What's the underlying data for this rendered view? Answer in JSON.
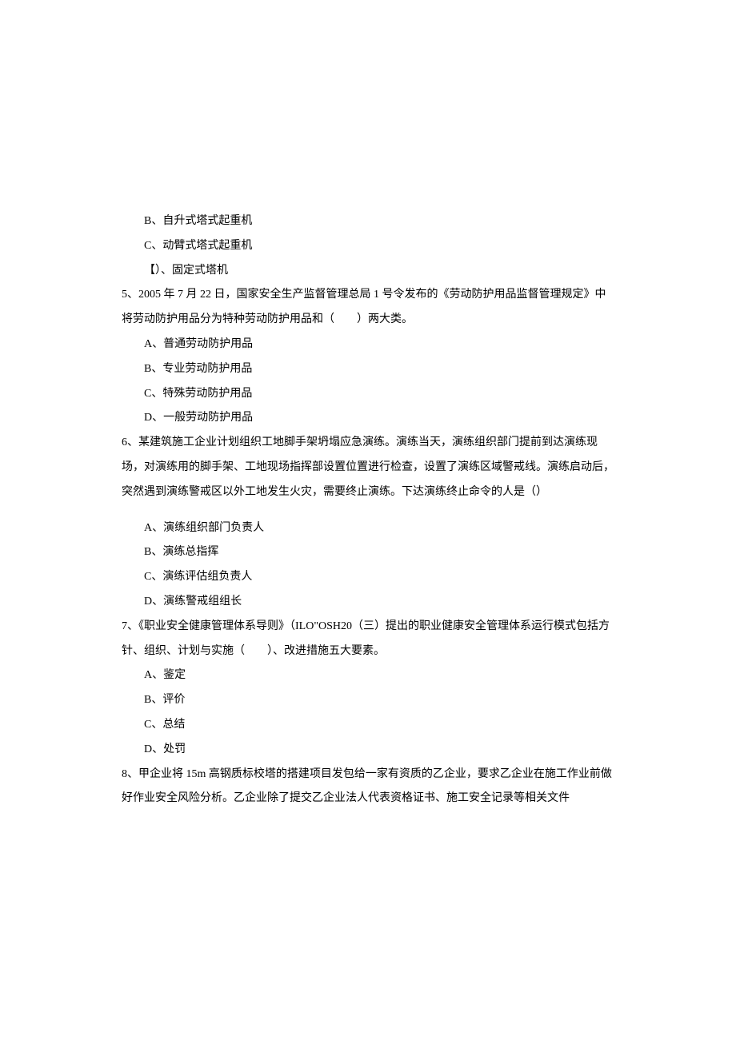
{
  "q4": {
    "options": {
      "b": "B、自升式塔式起重机",
      "c": "C、动臂式塔式起重机",
      "d": "【）、固定式塔机"
    }
  },
  "q5": {
    "stem": "5、2005 年 7 月 22 日，国家安全生产监督管理总局 1 号令发布的《劳动防护用品监督管理规定》中将劳动防护用品分为特种劳动防护用品和（　　）两大类。",
    "options": {
      "a": "A、普通劳动防护用品",
      "b": "B、专业劳动防护用品",
      "c": "C、特殊劳动防护用品",
      "d": "D、一般劳动防护用品"
    }
  },
  "q6": {
    "stem": "6、某建筑施工企业计划组织工地脚手架坍塌应急演练。演练当天，演练组织部门提前到达演练现场，对演练用的脚手架、工地现场指挥部设置位置进行检查，设置了演练区域警戒线。演练启动后，突然遇到演练警戒区以外工地发生火灾，需要终止演练。下达演练终止命令的人是（）",
    "options": {
      "a": "A、演练组织部门负责人",
      "b": "B、演练总指挥",
      "c": "C、演练评估组负责人",
      "d": "D、演练警戒组组长"
    }
  },
  "q7": {
    "stem": "7、《职业安全健康管理体系导则》（ILO\"OSH20（三）提出的职业健康安全管理体系运行模式包括方针、组织、计划与实施（　　）、改进措施五大要素。",
    "options": {
      "a": "A、鉴定",
      "b": "B、评价",
      "c": "C、总结",
      "d": "D、处罚"
    }
  },
  "q8": {
    "stem": "8、甲企业将 15m 高钢质标校塔的搭建项目发包给一家有资质的乙企业，要求乙企业在施工作业前做好作业安全风险分析。乙企业除了提交乙企业法人代表资格证书、施工安全记录等相关文件"
  }
}
